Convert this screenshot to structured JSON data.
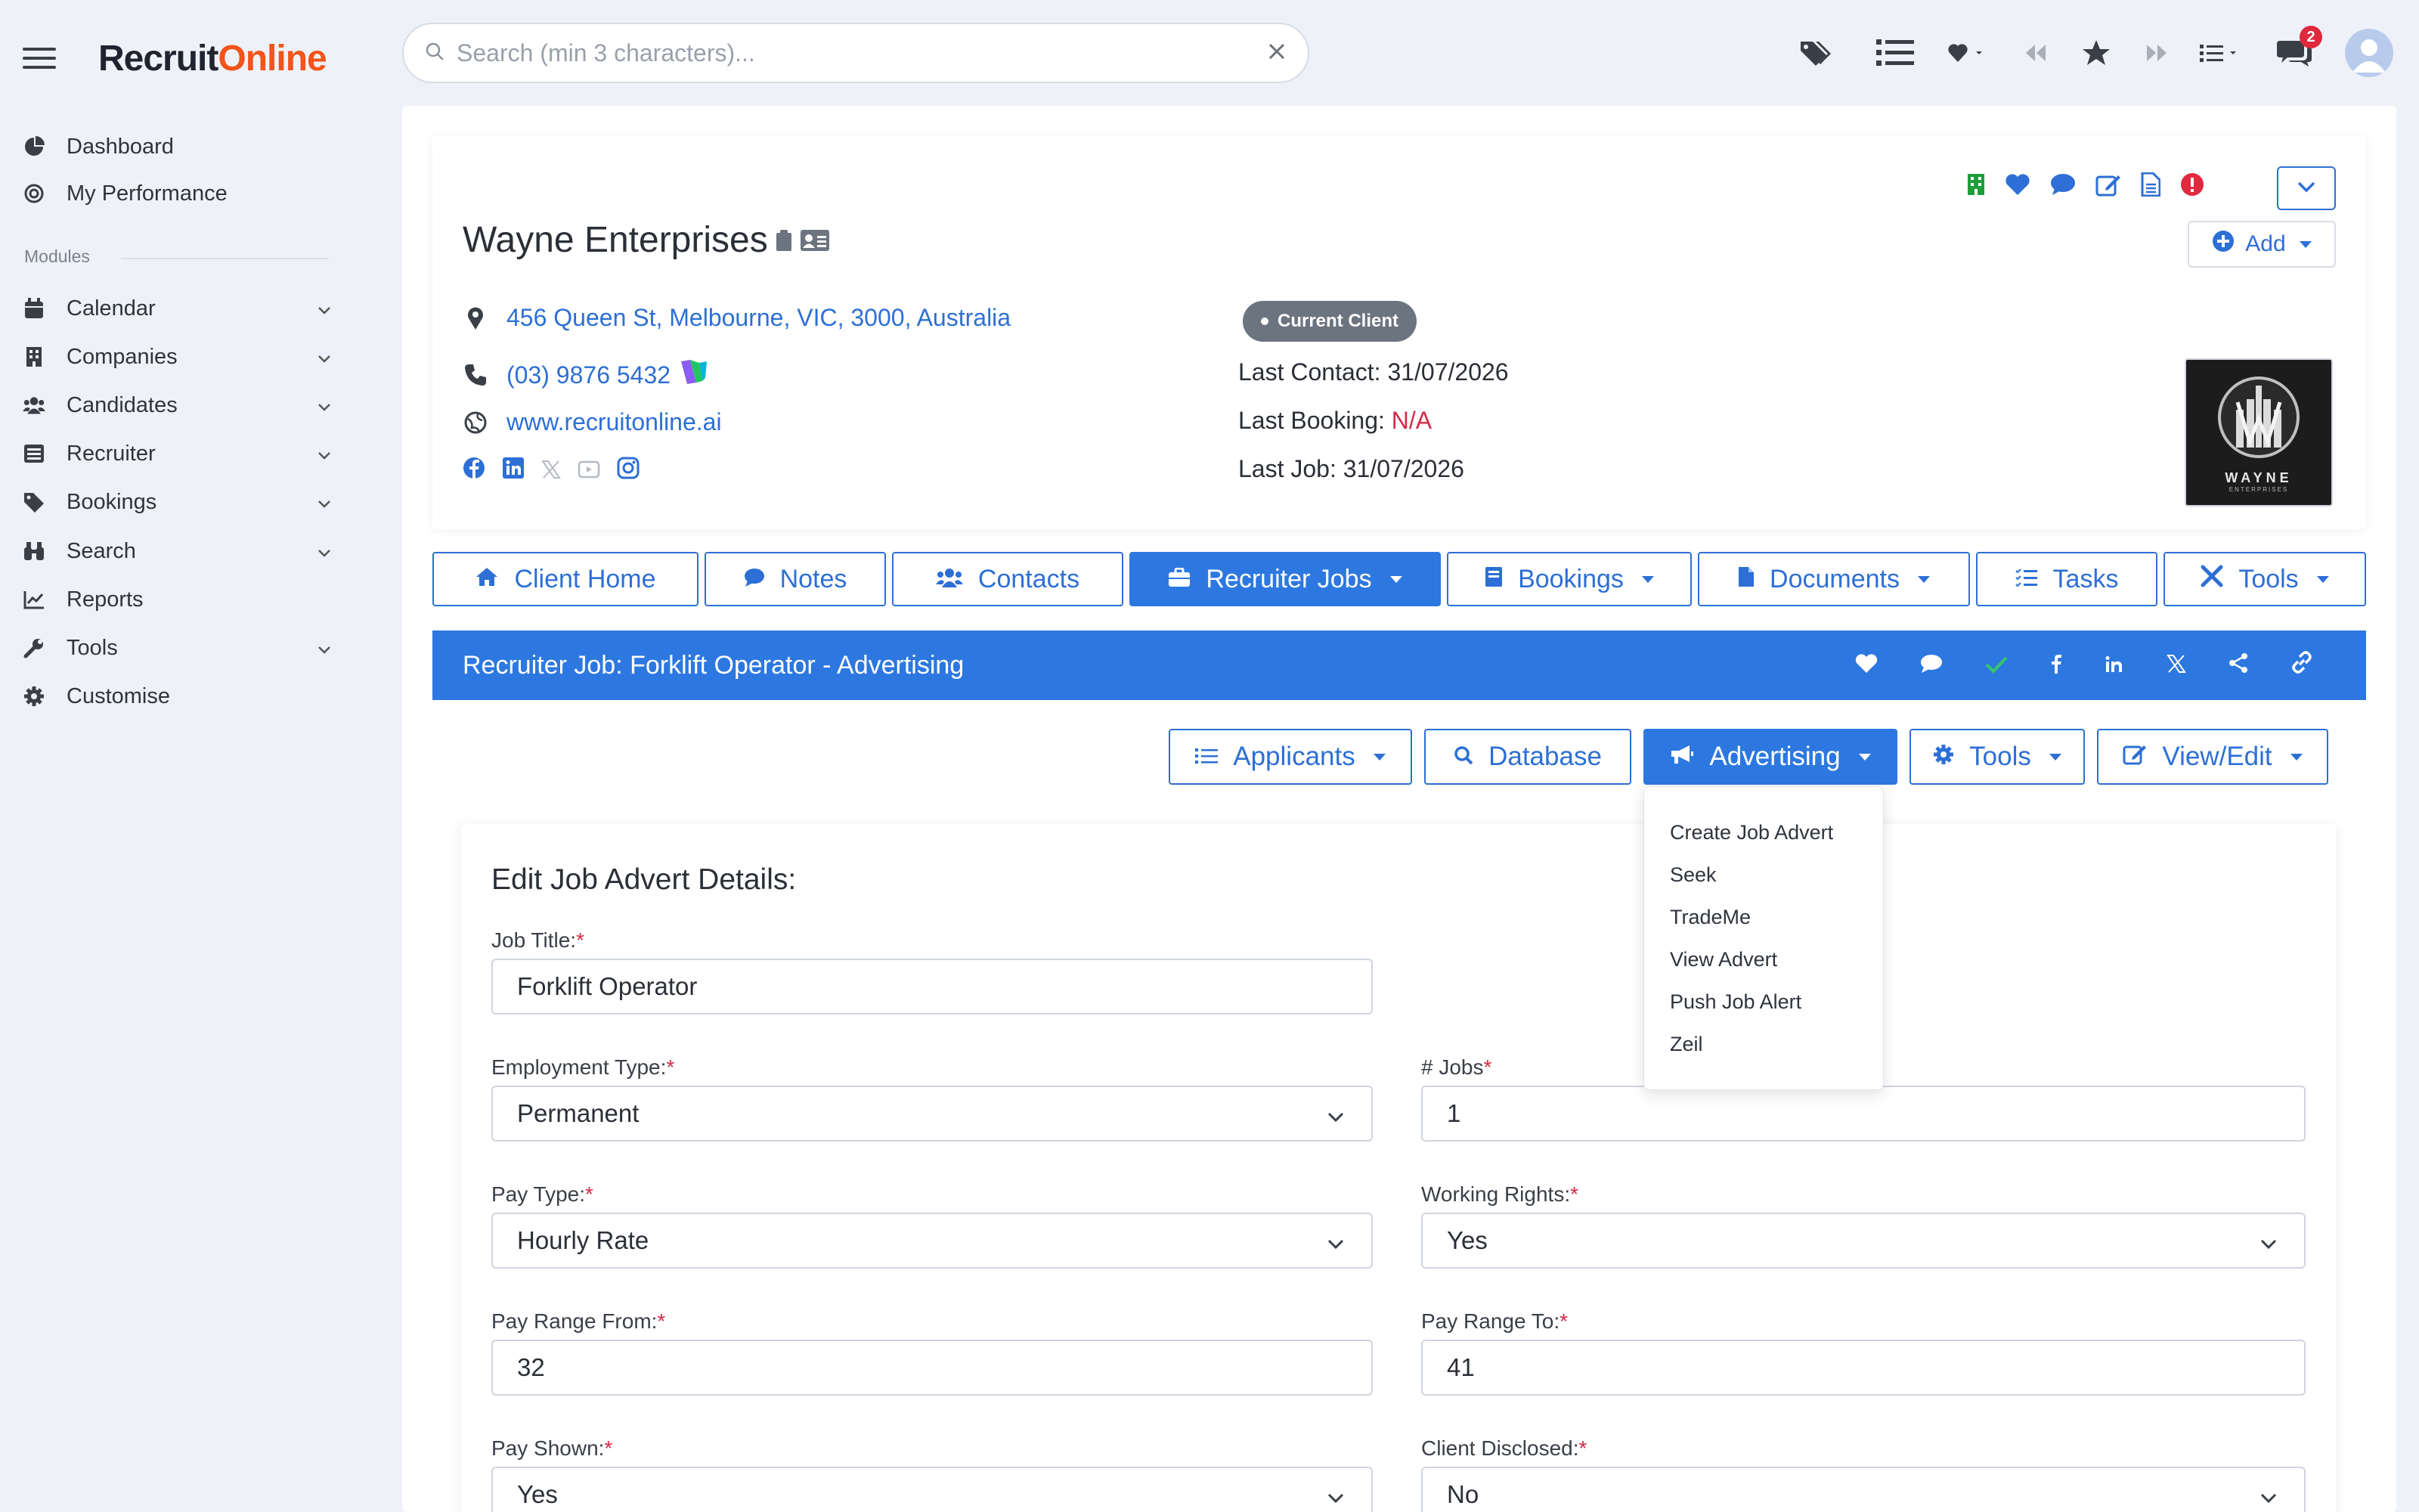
{
  "app": {
    "logo_part1": "Recruit",
    "logo_part2": "Online"
  },
  "sidebar": {
    "top_items": [
      {
        "label": "Dashboard",
        "icon": "pie-chart-icon"
      },
      {
        "label": "My Performance",
        "icon": "target-icon"
      }
    ],
    "modules_label": "Modules",
    "module_items": [
      {
        "label": "Calendar",
        "icon": "calendar-icon"
      },
      {
        "label": "Companies",
        "icon": "building-icon"
      },
      {
        "label": "Candidates",
        "icon": "users-icon"
      },
      {
        "label": "Recruiter",
        "icon": "list-icon"
      },
      {
        "label": "Bookings",
        "icon": "tags-icon"
      },
      {
        "label": "Search",
        "icon": "binoculars-icon"
      },
      {
        "label": "Reports",
        "icon": "chart-line-icon"
      },
      {
        "label": "Tools",
        "icon": "wrench-icon"
      },
      {
        "label": "Customise",
        "icon": "gear-icon"
      }
    ]
  },
  "search": {
    "placeholder": "Search (min 3 characters)..."
  },
  "topbar": {
    "notification_count": "2"
  },
  "company": {
    "name": "Wayne Enterprises",
    "address": "456 Queen St, Melbourne, VIC, 3000, Australia",
    "phone": "(03) 9876 5432",
    "website": "www.recruitonline.ai",
    "status": "Current Client",
    "last_contact_label": "Last Contact:",
    "last_contact_value": "31/07/2026",
    "last_booking_label": "Last Booking:",
    "last_booking_value": "N/A",
    "last_job_label": "Last Job:",
    "last_job_value": "31/07/2026",
    "add_label": "Add",
    "logo_text": "WAYNE",
    "logo_subtext": "ENTERPRISES"
  },
  "tabs": [
    {
      "label": "Client Home",
      "icon": "home-icon"
    },
    {
      "label": "Notes",
      "icon": "comment-icon"
    },
    {
      "label": "Contacts",
      "icon": "users-icon"
    },
    {
      "label": "Recruiter Jobs",
      "icon": "briefcase-icon"
    },
    {
      "label": "Bookings",
      "icon": "book-icon"
    },
    {
      "label": "Documents",
      "icon": "file-icon"
    },
    {
      "label": "Tasks",
      "icon": "list-check-icon"
    },
    {
      "label": "Tools",
      "icon": "tools-icon"
    }
  ],
  "job_bar": {
    "title": "Recruiter Job: Forklift Operator - Advertising"
  },
  "sub_toolbar": [
    {
      "label": "Applicants",
      "icon": "list-icon"
    },
    {
      "label": "Database",
      "icon": "search-icon"
    },
    {
      "label": "Advertising",
      "icon": "megaphone-icon"
    },
    {
      "label": "Tools",
      "icon": "gear-icon"
    },
    {
      "label": "View/Edit",
      "icon": "edit-icon"
    }
  ],
  "advertising_menu": [
    "Create Job Advert",
    "Seek",
    "TradeMe",
    "View Advert",
    "Push Job Alert",
    "Zeil"
  ],
  "form": {
    "title": "Edit Job Advert Details:",
    "job_title_label": "Job Title:",
    "job_title_value": "Forklift Operator",
    "employment_type_label": "Employment Type:",
    "employment_type_value": "Permanent",
    "jobs_label": "# Jobs",
    "jobs_value": "1",
    "pay_type_label": "Pay Type:",
    "pay_type_value": "Hourly Rate",
    "working_rights_label": "Working Rights:",
    "working_rights_value": "Yes",
    "pay_from_label": "Pay Range From:",
    "pay_from_value": "32",
    "pay_to_label": "Pay Range To:",
    "pay_to_value": "41",
    "pay_shown_label": "Pay Shown:",
    "pay_shown_value": "Yes",
    "client_disclosed_label": "Client Disclosed:",
    "client_disclosed_value": "No",
    "required_mark": "*"
  },
  "colors": {
    "primary": "#2d78e0",
    "link": "#2d6fd6",
    "brand_orange": "#f2541b",
    "danger": "#d42a47",
    "success": "#1f9d3a"
  }
}
